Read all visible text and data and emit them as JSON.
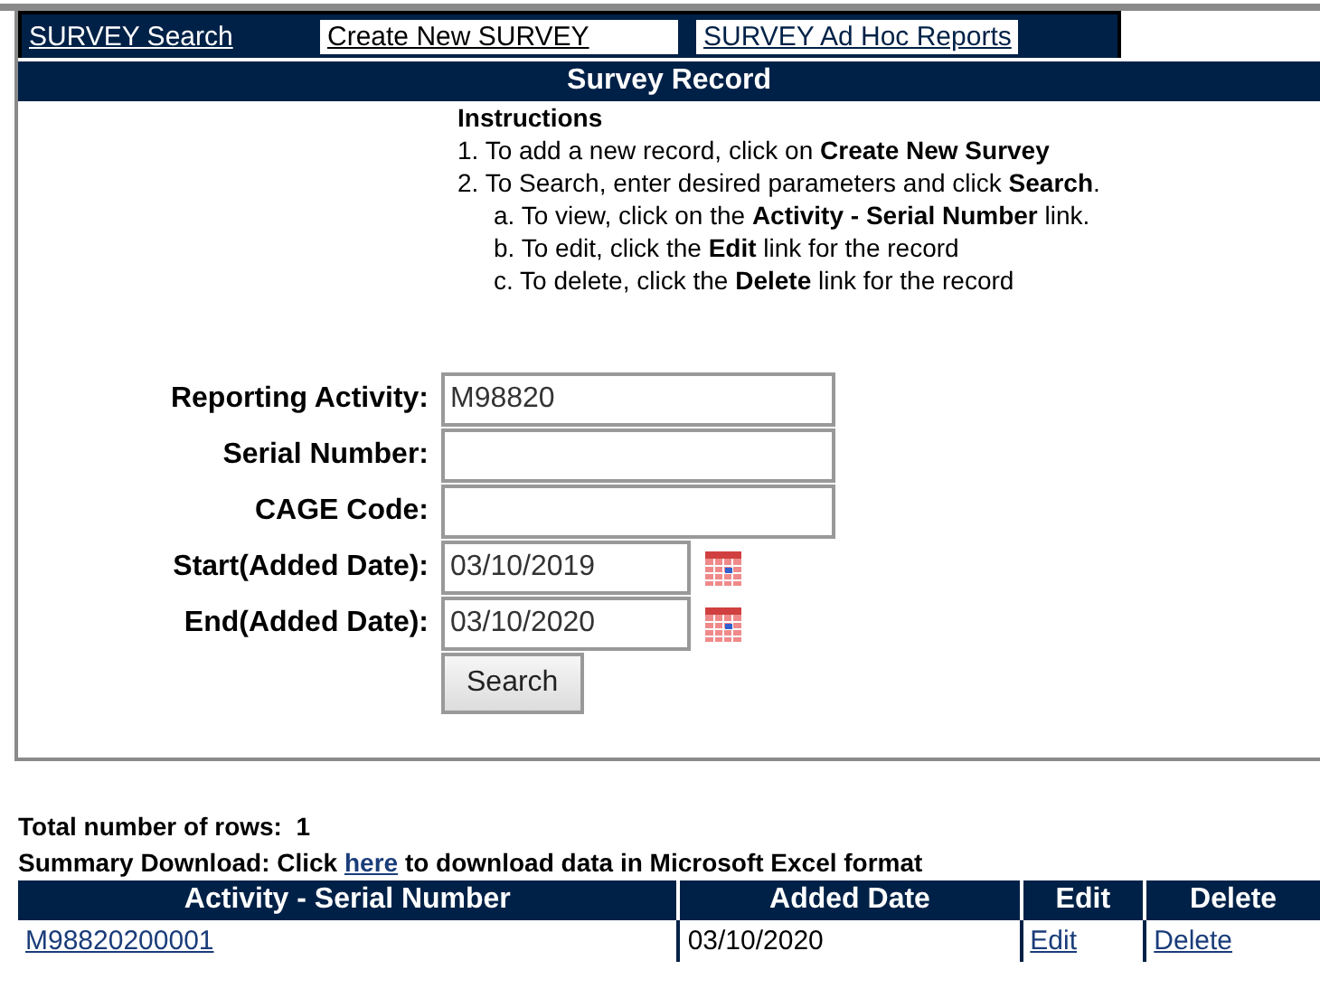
{
  "tabs": [
    {
      "label": "SURVEY Search",
      "selected": false
    },
    {
      "label": "Create New SURVEY",
      "selected": true
    },
    {
      "label": "SURVEY Ad Hoc Reports",
      "selected": false
    }
  ],
  "header": {
    "title": "Survey Record"
  },
  "instructions": {
    "title": "Instructions",
    "lines": [
      {
        "text": "1. To add a new record, click on **Create New Survey**",
        "indent": false
      },
      {
        "text": "2. To Search, enter desired parameters and click **Search**.",
        "indent": false
      },
      {
        "text": "a. To view, click on the **Activity - Serial Number** link.",
        "indent": true
      },
      {
        "text": "b. To edit, click the **Edit** link for the record",
        "indent": true
      },
      {
        "text": "c. To delete, click the **Delete** link for the record",
        "indent": true
      }
    ]
  },
  "form": {
    "fields": [
      {
        "label": "Reporting Activity:",
        "value": "M98820",
        "kind": "text"
      },
      {
        "label": "Serial Number:",
        "kind": "text"
      },
      {
        "label": "CAGE Code:",
        "kind": "text"
      },
      {
        "label": "Start(Added Date):",
        "value": "03/10/2019",
        "kind": "date"
      },
      {
        "label": "End(Added Date):",
        "value": "03/10/2020",
        "kind": "date"
      }
    ],
    "button": "Search"
  },
  "results": {
    "total_label": "Total number of rows:",
    "total": "1",
    "download": {
      "before": "Summary Download: Click",
      "link": "here",
      "after": "to download data in Microsoft Excel format"
    },
    "columns": [
      "Activity - Serial Number",
      "Added Date",
      "Edit",
      "Delete"
    ],
    "rows": [
      {
        "cells": [
          "M98820200001",
          "03/10/2020",
          "Edit",
          "Delete"
        ],
        "links": [
          true,
          false,
          true,
          true
        ]
      }
    ]
  }
}
